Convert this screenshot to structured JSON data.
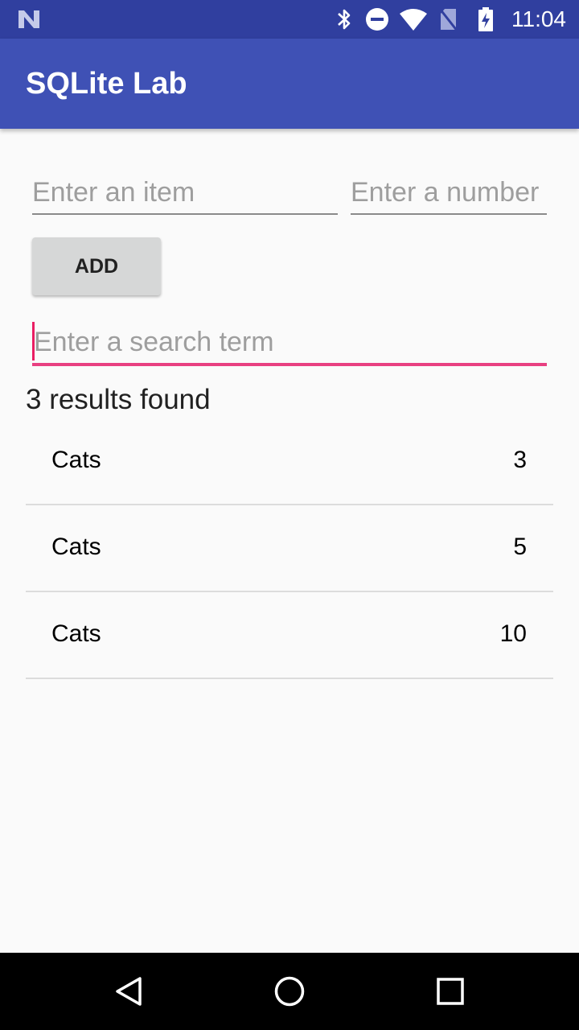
{
  "status_bar": {
    "time": "11:04",
    "icons": [
      "notification-n-icon",
      "bluetooth-icon",
      "do-not-disturb-icon",
      "wifi-icon",
      "no-sim-icon",
      "battery-charging-icon"
    ]
  },
  "app_bar": {
    "title": "SQLite Lab"
  },
  "form": {
    "item_placeholder": "Enter an item",
    "item_value": "",
    "number_placeholder": "Enter a number",
    "number_value": "",
    "add_label": "ADD",
    "search_placeholder": "Enter a search term",
    "search_value": ""
  },
  "results": {
    "summary": "3 results found",
    "items": [
      {
        "name": "Cats",
        "count": "3"
      },
      {
        "name": "Cats",
        "count": "5"
      },
      {
        "name": "Cats",
        "count": "10"
      }
    ]
  },
  "nav_bar": {
    "buttons": [
      "back-icon",
      "home-icon",
      "recents-icon"
    ]
  },
  "colors": {
    "status_bar": "#303f9f",
    "primary": "#3f51b5",
    "accent": "#e91e63",
    "background": "#fafafa"
  }
}
